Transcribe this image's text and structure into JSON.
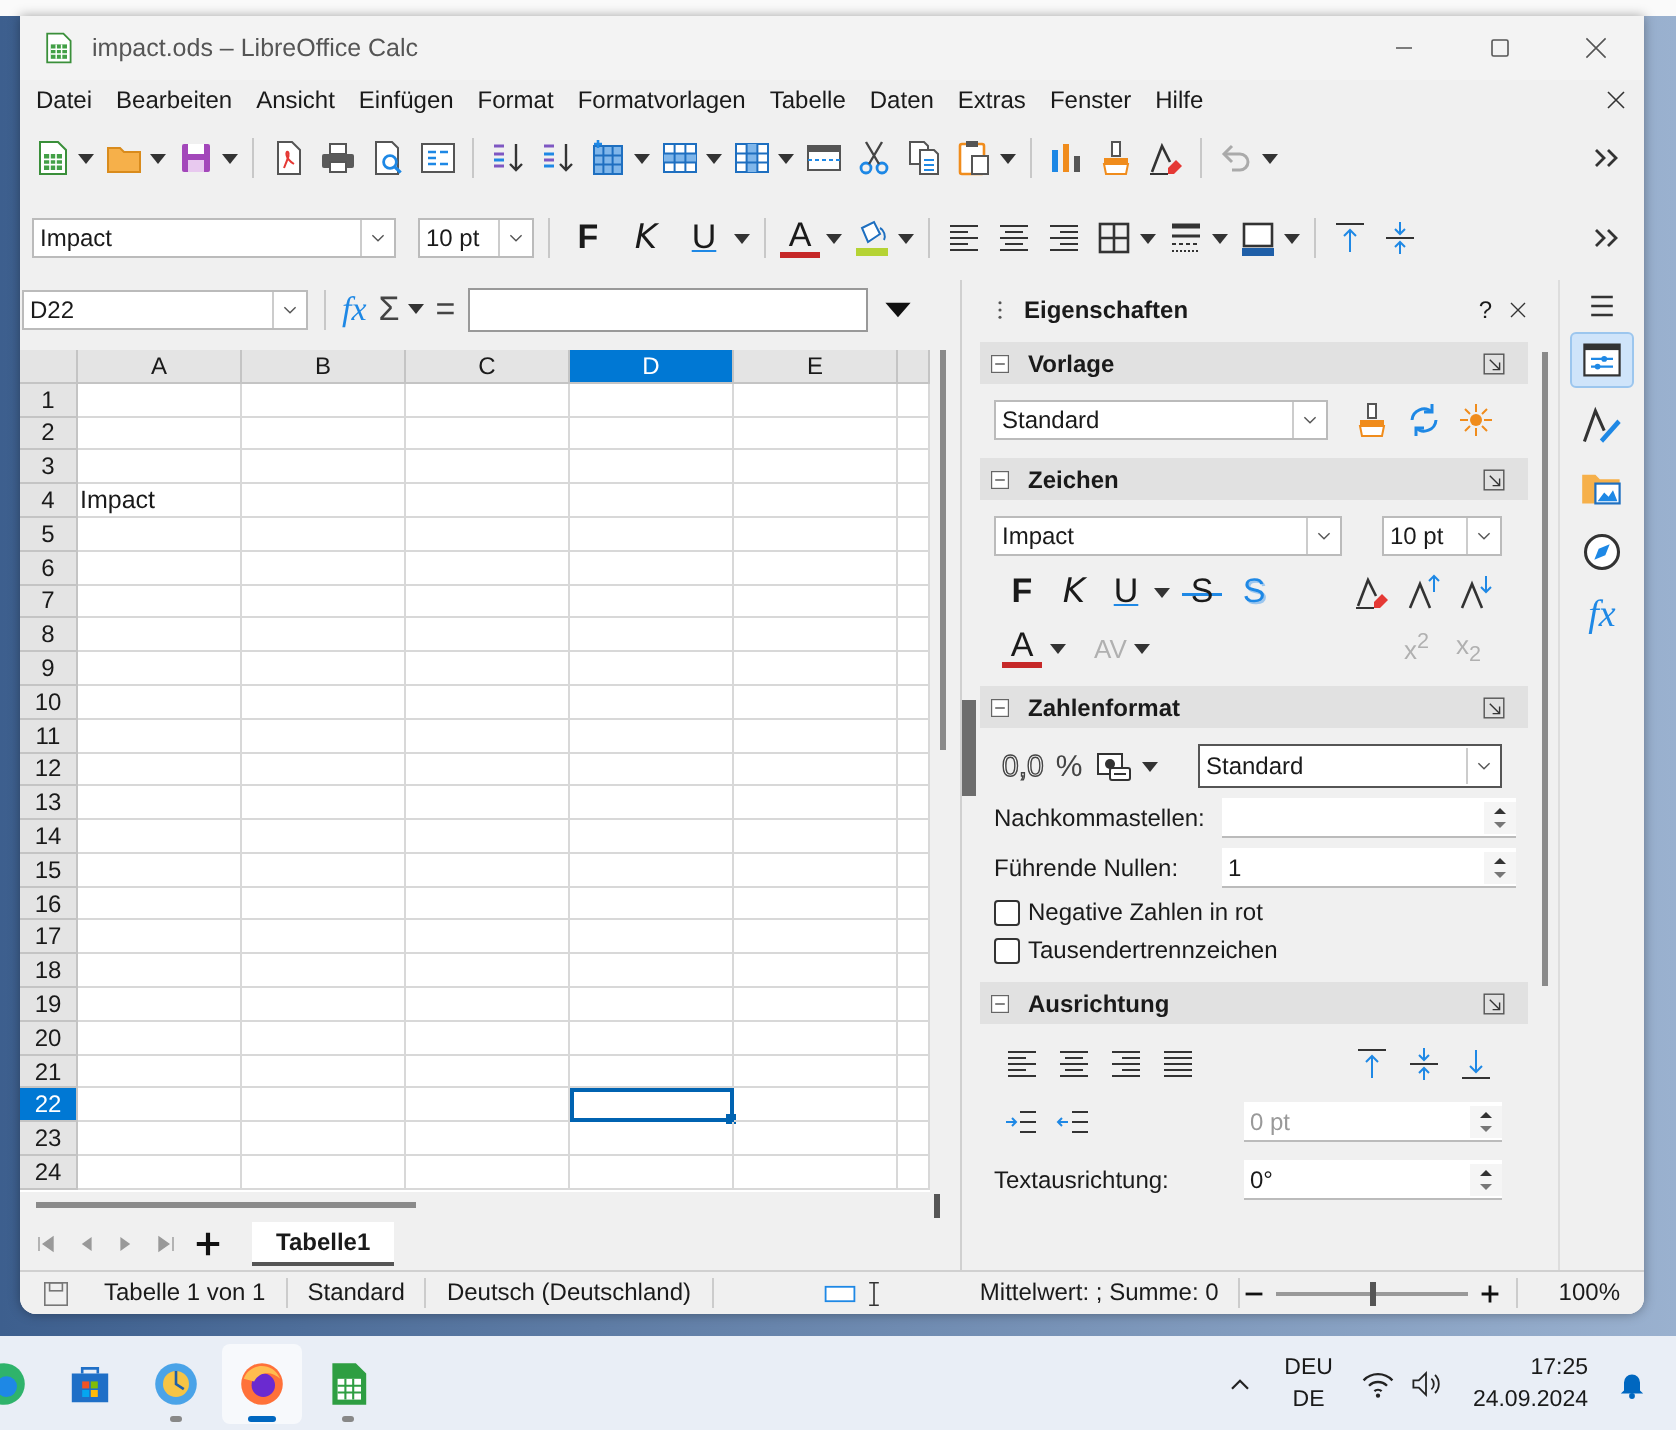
{
  "window": {
    "title": "impact.ods – LibreOffice Calc"
  },
  "menu": [
    "Datei",
    "Bearbeiten",
    "Ansicht",
    "Einfügen",
    "Format",
    "Formatvorlagen",
    "Tabelle",
    "Daten",
    "Extras",
    "Fenster",
    "Hilfe"
  ],
  "format_bar": {
    "font": "Impact",
    "size": "10 pt",
    "style_buttons": [
      {
        "label": "F",
        "kind": "bold"
      },
      {
        "label": "K",
        "kind": "italic"
      },
      {
        "label": "U",
        "kind": "underline"
      }
    ],
    "font_color": "A"
  },
  "formula_bar": {
    "cell_reference": "D22",
    "buttons": [
      "fx",
      "Σ",
      "="
    ]
  },
  "sheet": {
    "columns": [
      {
        "label": "A",
        "selected": false
      },
      {
        "label": "B",
        "selected": false
      },
      {
        "label": "C",
        "selected": false
      },
      {
        "label": "D",
        "selected": true
      },
      {
        "label": "E",
        "selected": false
      }
    ],
    "rows": [
      {
        "label": "1",
        "selected": false
      },
      {
        "label": "2",
        "selected": false
      },
      {
        "label": "3",
        "selected": false
      },
      {
        "label": "4",
        "selected": false,
        "cells": [
          "Impact"
        ]
      },
      {
        "label": "5",
        "selected": false
      },
      {
        "label": "6",
        "selected": false
      },
      {
        "label": "7",
        "selected": false
      },
      {
        "label": "8",
        "selected": false
      },
      {
        "label": "9",
        "selected": false
      },
      {
        "label": "10",
        "selected": false
      },
      {
        "label": "11",
        "selected": false
      },
      {
        "label": "12",
        "selected": false
      },
      {
        "label": "13",
        "selected": false
      },
      {
        "label": "14",
        "selected": false
      },
      {
        "label": "15",
        "selected": false
      },
      {
        "label": "16",
        "selected": false
      },
      {
        "label": "17",
        "selected": false
      },
      {
        "label": "18",
        "selected": false
      },
      {
        "label": "19",
        "selected": false
      },
      {
        "label": "20",
        "selected": false
      },
      {
        "label": "21",
        "selected": false
      },
      {
        "label": "22",
        "selected": true
      },
      {
        "label": "23",
        "selected": false
      },
      {
        "label": "24",
        "selected": false
      }
    ]
  },
  "sheet_tabs": [
    {
      "label": "Tabelle1",
      "selected": true
    }
  ],
  "sidebar": {
    "title": "Eigenschaften",
    "help": "?",
    "sections": [
      {
        "kind": "style",
        "title": "Vorlage",
        "expanded": true,
        "style": "Standard"
      },
      {
        "kind": "character",
        "title": "Zeichen",
        "expanded": true,
        "font": "Impact",
        "size": "10 pt",
        "buttons": [
          {
            "label": "F",
            "kind": "bold"
          },
          {
            "label": "K",
            "kind": "italic"
          },
          {
            "label": "U",
            "kind": "underline"
          },
          {
            "label": "S",
            "kind": "strike"
          },
          {
            "label": "S",
            "kind": "shadow"
          }
        ],
        "font_color": "A",
        "spacing": {
          "label": "AV",
          "disabled": true
        },
        "scripts": [
          {
            "label": "x$^{2}$",
            "disabled": true
          },
          {
            "label": "x$_{2}$",
            "disabled": true
          }
        ]
      },
      {
        "kind": "number",
        "title": "Zahlenformat",
        "expanded": true,
        "buttons": [
          "0,0",
          "%"
        ],
        "format": "Standard",
        "fields": [
          {
            "label": "Nachkommastellen:"
          },
          {
            "label": "Führende Nullen:",
            "value": "1"
          }
        ],
        "checkboxes": [
          {
            "label": "Negative Zahlen in rot",
            "checked": false
          },
          {
            "label": "Tausendertrennzeichen",
            "checked": false
          }
        ]
      },
      {
        "kind": "alignment",
        "title": "Ausrichtung",
        "expanded": true,
        "indent": {
          "value": "0 pt",
          "disabled": true
        },
        "rotation": {
          "label": "Textausrichtung:",
          "value": "0°"
        }
      }
    ],
    "tabs": [
      {
        "kind": "properties",
        "selected": true
      },
      {
        "kind": "styles",
        "selected": false
      },
      {
        "kind": "gallery",
        "selected": false
      },
      {
        "kind": "navigator",
        "selected": false
      },
      {
        "kind": "functions",
        "selected": false,
        "label": "fx"
      }
    ]
  },
  "status_bar": {
    "sheet": "Tabelle 1 von 1",
    "style": "Standard",
    "language": "Deutsch (Deutschland)",
    "summary": "Mittelwert: ; Summe: 0",
    "zoom_slider": {
      "level": 0.5
    },
    "zoom": "100%"
  },
  "taskbar": {
    "apps": [
      {
        "kind": "edge",
        "selected": false,
        "running": false
      },
      {
        "kind": "store",
        "selected": false,
        "running": false
      },
      {
        "kind": "globe",
        "selected": false,
        "running": true
      },
      {
        "kind": "firefox",
        "selected": true,
        "running": true
      },
      {
        "kind": "calc",
        "selected": false,
        "running": true
      }
    ],
    "language": [
      "DEU",
      "DE"
    ],
    "time": "17:25",
    "date": "24.09.2024"
  }
}
